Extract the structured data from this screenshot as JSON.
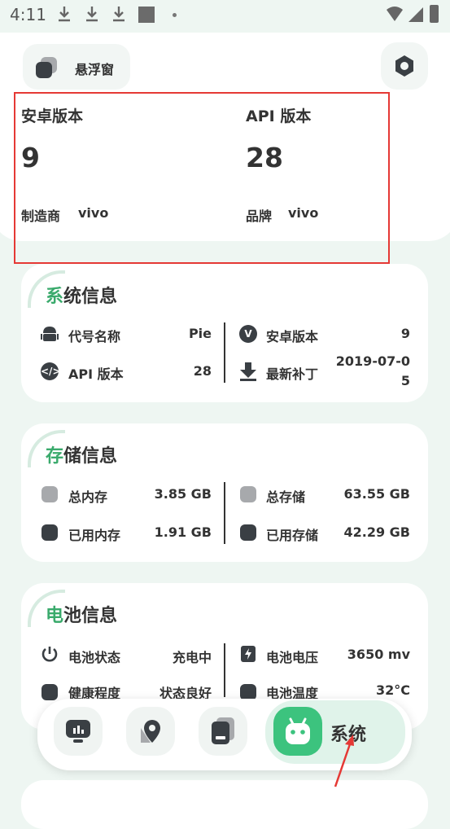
{
  "status_bar": {
    "time": "4:11"
  },
  "header": {
    "float_window_label": "悬浮窗"
  },
  "summary": {
    "android_version_label": "安卓版本",
    "android_version_value": "9",
    "api_version_label": "API 版本",
    "api_version_value": "28",
    "manufacturer_label": "制造商",
    "manufacturer_value": "vivo",
    "brand_label": "品牌",
    "brand_value": "vivo"
  },
  "system_info": {
    "title_accent": "系",
    "title_rest": "统信息",
    "codename_label": "代号名称",
    "codename_value": "Pie",
    "android_label": "安卓版本",
    "android_value": "9",
    "api_label": "API 版本",
    "api_value": "28",
    "patch_label": "最新补丁",
    "patch_value_line1": "2019-07-0",
    "patch_value_line2": "5"
  },
  "storage_info": {
    "title_accent": "存",
    "title_rest": "储信息",
    "total_mem_label": "总内存",
    "total_mem_value": "3.85 GB",
    "used_mem_label": "已用内存",
    "used_mem_value": "1.91 GB",
    "total_storage_label": "总存储",
    "total_storage_value": "63.55 GB",
    "used_storage_label": "已用存储",
    "used_storage_value": "42.29 GB"
  },
  "battery_info": {
    "title_accent": "电",
    "title_rest": "池信息",
    "status_label": "电池状态",
    "status_value": "充电中",
    "voltage_label": "电池电压",
    "voltage_value": "3650 mv",
    "health_label": "健康程度",
    "health_value": "状态良好",
    "temp_label": "电池温度",
    "temp_value": "32°C"
  },
  "bottom_nav": {
    "active_label": "系统"
  },
  "colors": {
    "accent": "#3aaa6c",
    "highlight_box": "#e53935",
    "active_nav": "#3cc37e"
  }
}
